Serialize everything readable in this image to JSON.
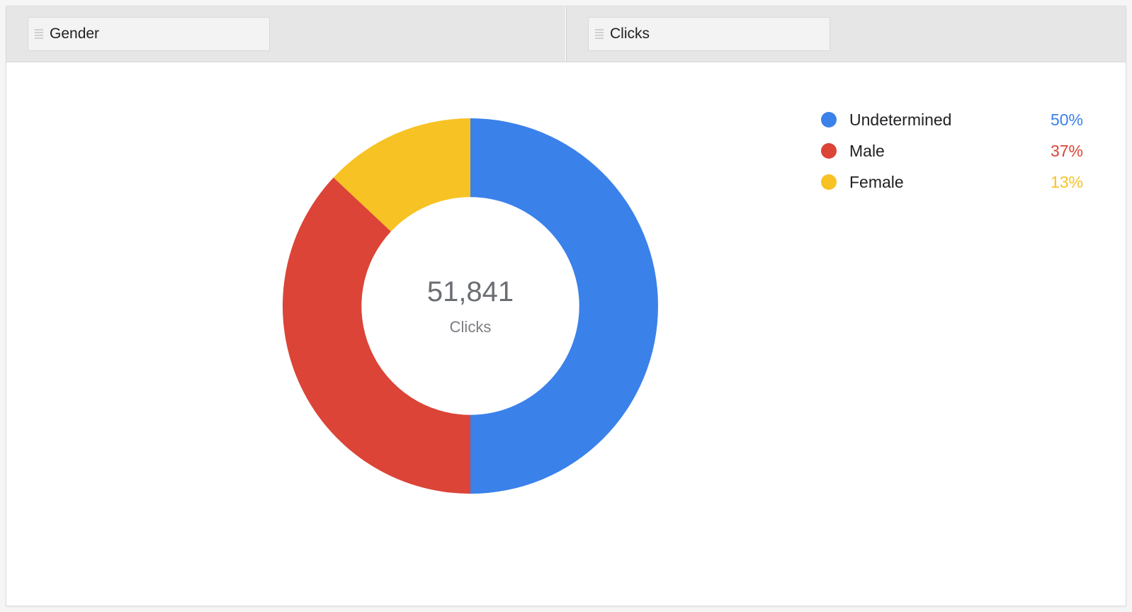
{
  "header": {
    "dimension_label": "Gender",
    "metric_label": "Clicks"
  },
  "center": {
    "value": "51,841",
    "label": "Clicks"
  },
  "legend": [
    {
      "name": "Undetermined",
      "pct": "50%",
      "color": "#3a81ea"
    },
    {
      "name": "Male",
      "pct": "37%",
      "color": "#db4437"
    },
    {
      "name": "Female",
      "pct": "13%",
      "color": "#f7c223"
    }
  ],
  "chart_data": {
    "type": "pie",
    "title": "",
    "series": [
      {
        "name": "Undetermined",
        "value": 50,
        "color": "#3a81ea"
      },
      {
        "name": "Male",
        "value": 37,
        "color": "#db4437"
      },
      {
        "name": "Female",
        "value": 13,
        "color": "#f7c223"
      }
    ],
    "total_value": 51841,
    "total_label": "Clicks",
    "donut_inner_ratio": 0.58
  }
}
